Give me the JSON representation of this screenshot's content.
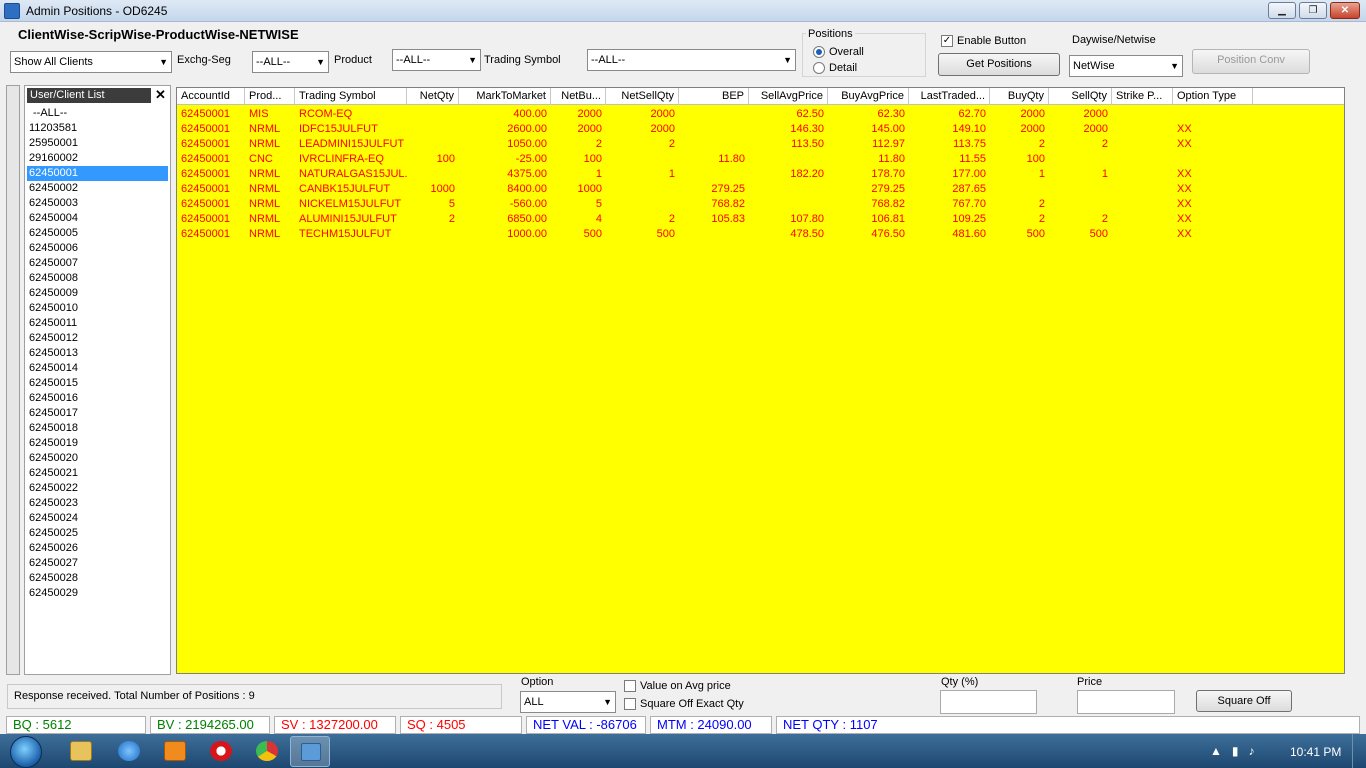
{
  "window": {
    "title": "Admin Positions - OD6245",
    "minimize": "▁",
    "maximize": "❐",
    "close": "✕"
  },
  "heading": "ClientWise-ScripWise-ProductWise-NETWISE",
  "filters": {
    "clients": "Show All Clients",
    "exchg_label": "Exchg-Seg",
    "exchg_value": "--ALL--",
    "product_label": "Product",
    "product_value": "--ALL--",
    "symbol_label": "Trading Symbol",
    "symbol_value": "--ALL--"
  },
  "positions": {
    "label": "Positions",
    "overall": "Overall",
    "detail": "Detail",
    "selected": "Overall"
  },
  "controls": {
    "enable_button": "Enable Button",
    "enable_checked": true,
    "get_positions": "Get Positions",
    "daywise_label": "Daywise/Netwise",
    "daywise_value": "NetWise",
    "position_conv": "Position Conv"
  },
  "client_panel": {
    "title": "User/Client List",
    "close": "✕",
    "selected": "62450001",
    "items": [
      "--ALL--",
      "11203581",
      "25950001",
      "29160002",
      "62450001",
      "62450002",
      "62450003",
      "62450004",
      "62450005",
      "62450006",
      "62450007",
      "62450008",
      "62450009",
      "62450010",
      "62450011",
      "62450012",
      "62450013",
      "62450014",
      "62450015",
      "62450016",
      "62450017",
      "62450018",
      "62450019",
      "62450020",
      "62450021",
      "62450022",
      "62450023",
      "62450024",
      "62450025",
      "62450026",
      "62450027",
      "62450028",
      "62450029"
    ]
  },
  "grid": {
    "columns": [
      "AccountId",
      "Prod...",
      "Trading Symbol",
      "NetQty",
      "MarkToMarket",
      "NetBu...",
      "NetSellQty",
      "BEP",
      "SellAvgPrice",
      "BuyAvgPrice",
      "LastTraded...",
      "BuyQty",
      "SellQty",
      "Strike P...",
      "Option Type"
    ],
    "rows": [
      [
        "62450001",
        "MIS",
        "RCOM-EQ",
        "",
        "400.00",
        "2000",
        "2000",
        "",
        "62.50",
        "62.30",
        "62.70",
        "2000",
        "2000",
        "",
        ""
      ],
      [
        "62450001",
        "NRML",
        "IDFC15JULFUT",
        "",
        "2600.00",
        "2000",
        "2000",
        "",
        "146.30",
        "145.00",
        "149.10",
        "2000",
        "2000",
        "",
        "XX"
      ],
      [
        "62450001",
        "NRML",
        "LEADMINI15JULFUT",
        "",
        "1050.00",
        "2",
        "2",
        "",
        "113.50",
        "112.97",
        "113.75",
        "2",
        "2",
        "",
        "XX"
      ],
      [
        "62450001",
        "CNC",
        "IVRCLINFRA-EQ",
        "100",
        "-25.00",
        "100",
        "",
        "11.80",
        "",
        "11.80",
        "11.55",
        "100",
        "",
        "",
        ""
      ],
      [
        "62450001",
        "NRML",
        "NATURALGAS15JUL...",
        "",
        "4375.00",
        "1",
        "1",
        "",
        "182.20",
        "178.70",
        "177.00",
        "1",
        "1",
        "",
        "XX"
      ],
      [
        "62450001",
        "NRML",
        "CANBK15JULFUT",
        "1000",
        "8400.00",
        "1000",
        "",
        "279.25",
        "",
        "279.25",
        "287.65",
        "",
        "",
        "",
        "XX"
      ],
      [
        "62450001",
        "NRML",
        "NICKELM15JULFUT",
        "5",
        "-560.00",
        "5",
        "",
        "768.82",
        "",
        "768.82",
        "767.70",
        "2",
        "",
        "",
        "XX"
      ],
      [
        "62450001",
        "NRML",
        "ALUMINI15JULFUT",
        "2",
        "6850.00",
        "4",
        "2",
        "105.83",
        "107.80",
        "106.81",
        "109.25",
        "2",
        "2",
        "",
        "XX"
      ],
      [
        "62450001",
        "NRML",
        "TECHM15JULFUT",
        "",
        "1000.00",
        "500",
        "500",
        "",
        "478.50",
        "476.50",
        "481.60",
        "500",
        "500",
        "",
        "XX"
      ]
    ]
  },
  "footer": {
    "status": "Response received. Total Number of Positions : 9",
    "option_label": "Option",
    "option_value": "ALL",
    "value_on_avg": "Value on Avg  price",
    "square_off_exact": "Square Off Exact Qty",
    "qty_label": "Qty (%)",
    "price_label": "Price",
    "square_off": "Square Off"
  },
  "summary": {
    "bq": "BQ : 5612",
    "bv": "BV : 2194265.00",
    "sv": "SV : 1327200.00",
    "sq": "SQ : 4505",
    "net_val": "NET VAL : -86706",
    "mtm": "MTM : 24090.00",
    "net_qty": "NET QTY : 1107"
  },
  "taskbar": {
    "clock": "10:41 PM"
  },
  "colors": {
    "grid_bg": "#ffff00",
    "row_text": "#ff0000",
    "green": "#008000",
    "blue": "#0000ff"
  }
}
